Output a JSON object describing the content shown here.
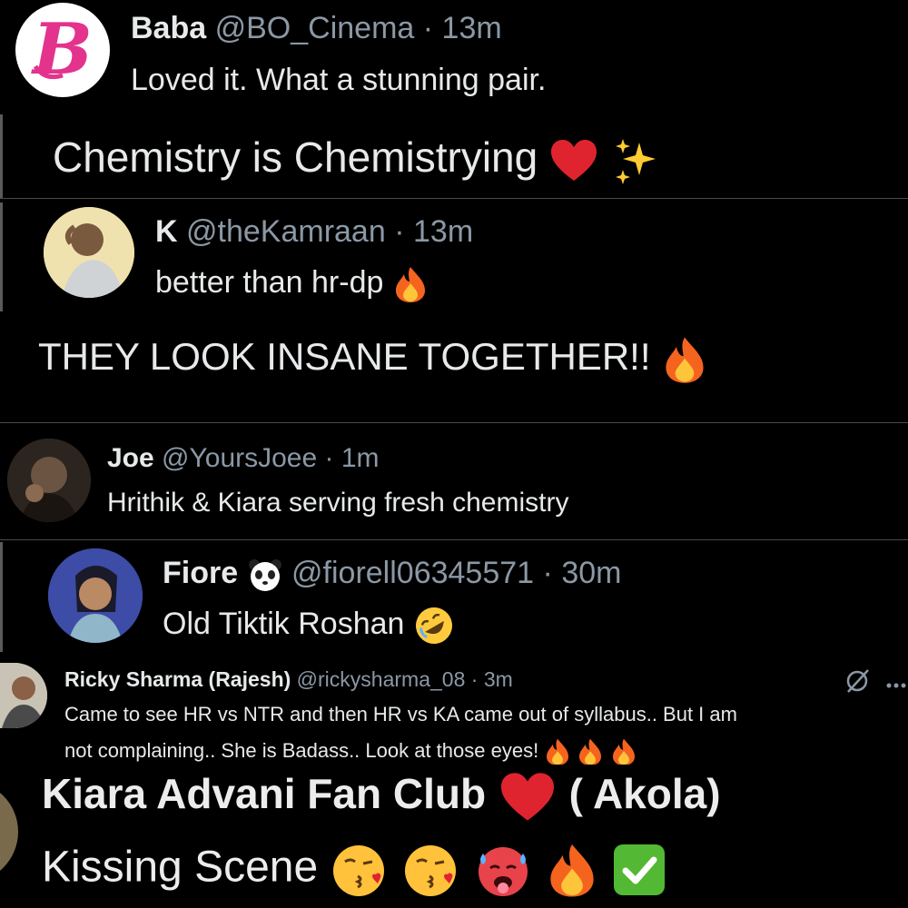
{
  "tweets": [
    {
      "name": "Baba",
      "handle": "@BO_Cinema",
      "sep": "·",
      "time": "13m",
      "text": "Loved it. What a stunning pair.",
      "caption": "Chemistry is Chemistrying"
    },
    {
      "name": "K",
      "handle": "@theKamraan",
      "sep": "·",
      "time": "13m",
      "text": "better than hr-dp",
      "caption": "THEY LOOK INSANE TOGETHER!!"
    },
    {
      "name": "Joe",
      "handle": "@YoursJoee",
      "sep": "·",
      "time": "1m",
      "text": "Hrithik & Kiara serving fresh chemistry"
    },
    {
      "name": "Fiore",
      "handle": "@fiorell06345571",
      "sep": "·",
      "time": "30m",
      "text": "Old Tiktik Roshan"
    },
    {
      "name": "Ricky Sharma (Rajesh)",
      "handle": "@rickysharma_08",
      "sep": "·",
      "time": "3m",
      "text_line1": "Came to see HR vs NTR and then HR vs KA came out of syllabus.. But I am",
      "text_line2": "not complaining.. She is Badass.. Look at those eyes!"
    },
    {
      "title_main": "Kiara Advani Fan Club",
      "title_suffix": "( Akola)",
      "caption": "Kissing Scene"
    }
  ],
  "icons": [
    "baba-logo-icon",
    "heart-icon",
    "sparkles-icon",
    "fire-icon",
    "panda-icon",
    "rofl-icon",
    "grok-icon",
    "more-icon",
    "kiss-icon",
    "hot-face-icon",
    "check-icon"
  ],
  "colors": {
    "background": "#000000",
    "text": "#e7e9ea",
    "secondary": "#8b98a5",
    "heart": "#e0242f",
    "baba_pink": "#e3338d"
  }
}
